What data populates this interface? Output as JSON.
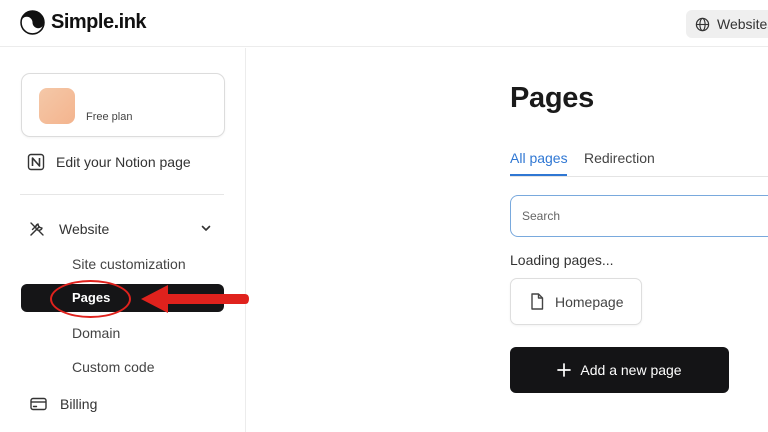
{
  "brand": {
    "name": "Simple.ink"
  },
  "topbar": {
    "websites_label": "Websites"
  },
  "sidebar": {
    "plan": {
      "label": "Free plan"
    },
    "notion_link": {
      "label": "Edit your Notion page"
    },
    "website_section": {
      "label": "Website"
    },
    "sub_items": [
      {
        "label": "Site customization"
      },
      {
        "label": "Pages"
      },
      {
        "label": "Domain"
      },
      {
        "label": "Custom code"
      }
    ],
    "billing": {
      "label": "Billing"
    }
  },
  "main": {
    "title": "Pages",
    "tabs": [
      {
        "label": "All pages",
        "active": true
      },
      {
        "label": "Redirection",
        "active": false
      }
    ],
    "search": {
      "placeholder": "Search",
      "value": ""
    },
    "loading_text": "Loading pages...",
    "pages": [
      {
        "label": "Homepage"
      }
    ],
    "add_button_label": "Add a new page"
  },
  "colors": {
    "accent": "#2f77d3",
    "dark_button": "#141416",
    "annotation": "#e0221d"
  }
}
